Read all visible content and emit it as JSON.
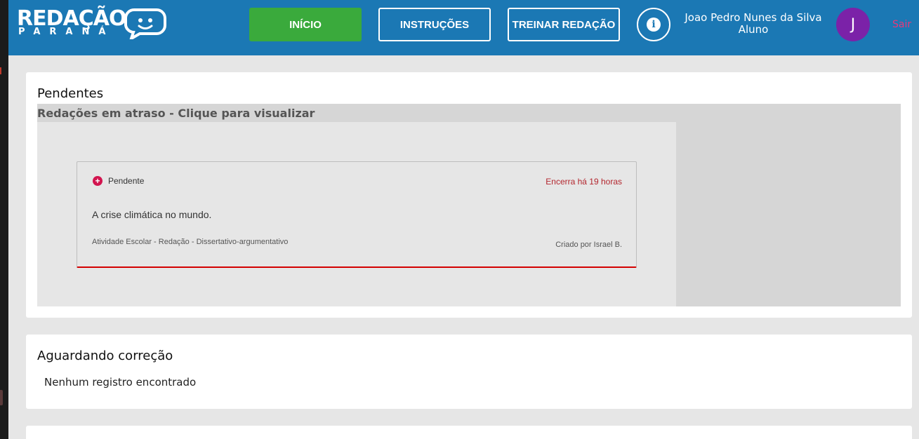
{
  "logo": {
    "word": "REDAÇÃO",
    "sub": "PARANÁ"
  },
  "nav": {
    "inicio": "INÍCIO",
    "instrucoes": "INSTRUÇÕES",
    "treinar": "TREINAR REDAÇÃO"
  },
  "user": {
    "name": "Joao Pedro Nunes da Silva",
    "role": "Aluno",
    "avatar_initial": "J"
  },
  "logout_label": "Sair",
  "pending": {
    "title": "Pendentes",
    "late_heading": "Redações em atraso - Clique para visualizar",
    "items": [
      {
        "status": "Pendente",
        "deadline": "Encerra há 19 horas",
        "theme": "A crise climática no mundo.",
        "meta": "Atividade Escolar - Redação - Dissertativo-argumentativo",
        "author": "Criado por Israel B."
      }
    ]
  },
  "awaiting": {
    "title": "Aguardando correção",
    "empty": "Nenhum registro encontrado"
  },
  "colors": {
    "header": "#1b78b4",
    "primary_button": "#3aaa3c",
    "avatar": "#7b22a8",
    "logout": "#e8387a",
    "overdue": "#d40000"
  },
  "icons": [
    "speech-bubble-logo-icon",
    "info-icon",
    "plus-circle-icon"
  ]
}
